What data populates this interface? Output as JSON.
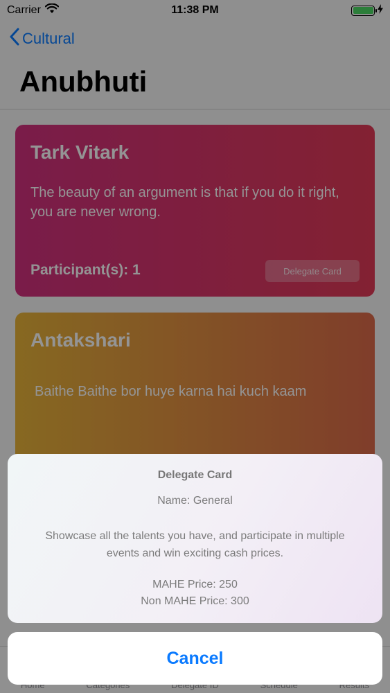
{
  "status_bar": {
    "carrier": "Carrier",
    "time": "11:38 PM",
    "battery_level": 1.0,
    "battery_color": "#4cd964"
  },
  "nav": {
    "back_label": "Cultural",
    "title": "Anubhuti"
  },
  "cards": [
    {
      "title": "Tark Vitark",
      "description": " The beauty of an argument is that if you do it right, you are never wrong.",
      "participants": "Participant(s): 1",
      "button_label": "Delegate Card",
      "gradient": [
        "#d2317f",
        "#e23a57"
      ]
    },
    {
      "title": "Antakshari",
      "description": "Baithe Baithe bor huye karna hai kuch kaam",
      "gradient": [
        "#e8b43a",
        "#dc6a4a"
      ]
    }
  ],
  "tab_bar": {
    "items": [
      "Home",
      "Categories",
      "Delegate ID",
      "Schedule",
      "Results"
    ]
  },
  "action_sheet": {
    "title": "Delegate Card",
    "name": "Name: General",
    "description": "Showcase all the talents you have, and participate in multiple events and win exciting cash prices.",
    "mahe_price": "MAHE Price: 250",
    "non_mahe_price": "Non MAHE Price: 300",
    "cancel_label": "Cancel"
  },
  "colors": {
    "accent": "#0a7aff"
  },
  "icons": {
    "wifi": "wifi-icon",
    "back": "chevron-left-icon",
    "charging": "bolt-icon"
  }
}
